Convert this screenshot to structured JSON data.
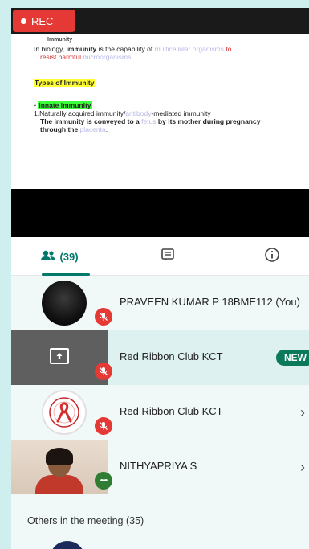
{
  "recording": {
    "label": "REC",
    "color": "#e53935"
  },
  "slide": {
    "heading": "Immunity",
    "line1_pre": "In biology, ",
    "line1_bold": "immunity",
    "line1_mid": " is the capability of ",
    "line1_link": "multicellular organisms",
    "line1_post": " to",
    "line2_pre": "resist harmful ",
    "line2_link": "microorganisms",
    "line2_post": ".",
    "types_heading": "Types of Immunity",
    "innate": "Innate immunity",
    "acquired_pre": "1.Naturally acquired  immunity/",
    "acquired_link": "antibody",
    "acquired_post": "-mediated immunity",
    "conveyed_pre": "The immunity is conveyed to a ",
    "conveyed_link": "fetus",
    "conveyed_post": " by its mother during pregnancy",
    "through_pre": "through the ",
    "through_link": "placenta",
    "through_post": "."
  },
  "tabs": {
    "people_icon": "people-icon",
    "people_count": "(39)",
    "chat_icon": "chat-icon",
    "info_icon": "info-icon",
    "accent": "#00796b"
  },
  "participants": [
    {
      "name": "PRAVEEN KUMAR P 18BME112 (You)",
      "status_icon": "mic-off-icon"
    },
    {
      "name": "Red Ribbon Club KCT",
      "status_icon": "mic-off-icon",
      "badge": "NEW"
    },
    {
      "name": "Red Ribbon Club KCT",
      "status_icon": "mic-off-icon",
      "trailing": "›"
    },
    {
      "name": "NITHYAPRIYA S",
      "status_icon": "more-icon",
      "trailing": "›"
    }
  ],
  "others": {
    "label": "Others in the meeting (35)"
  }
}
